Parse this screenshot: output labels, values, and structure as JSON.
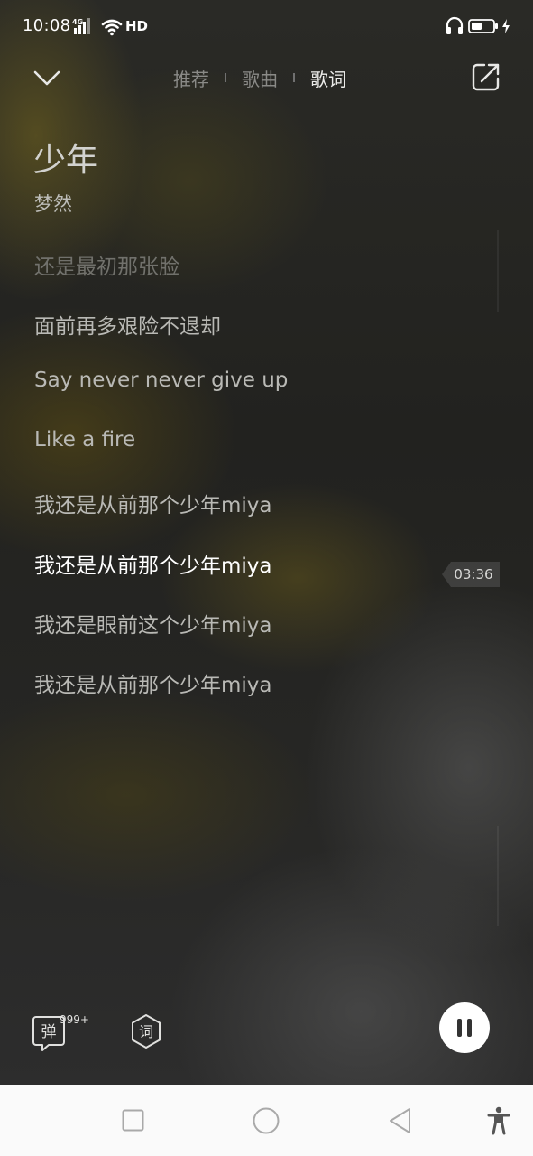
{
  "status_bar": {
    "time": "10:08",
    "network": "4G",
    "hd": "HD"
  },
  "top_nav": {
    "tabs": [
      {
        "label": "推荐",
        "active": false
      },
      {
        "label": "歌曲",
        "active": false
      },
      {
        "label": "歌词",
        "active": true
      }
    ]
  },
  "song": {
    "title": "少年",
    "artist": "梦然"
  },
  "lyrics": [
    {
      "text": "还是最初那张脸",
      "state": "dim"
    },
    {
      "text": "面前再多艰险不退却",
      "state": "normal"
    },
    {
      "text": "Say never never give up",
      "state": "normal"
    },
    {
      "text": "Like a fire",
      "state": "normal"
    },
    {
      "text": "我还是从前那个少年miya",
      "state": "normal"
    },
    {
      "text": "我还是从前那个少年miya",
      "state": "current"
    },
    {
      "text": "我还是眼前这个少年miya",
      "state": "normal"
    },
    {
      "text": "我还是从前那个少年miya",
      "state": "normal"
    }
  ],
  "scrub_time": "03:36",
  "bottom_controls": {
    "danmaku_label": "弹",
    "danmaku_count": "999+",
    "lyric_label": "词"
  },
  "colors": {
    "current_lyric": "#ffffff",
    "lyric": "#b9b9b5",
    "dim_lyric": "#71716c",
    "nav_bar": "#fafafa"
  }
}
